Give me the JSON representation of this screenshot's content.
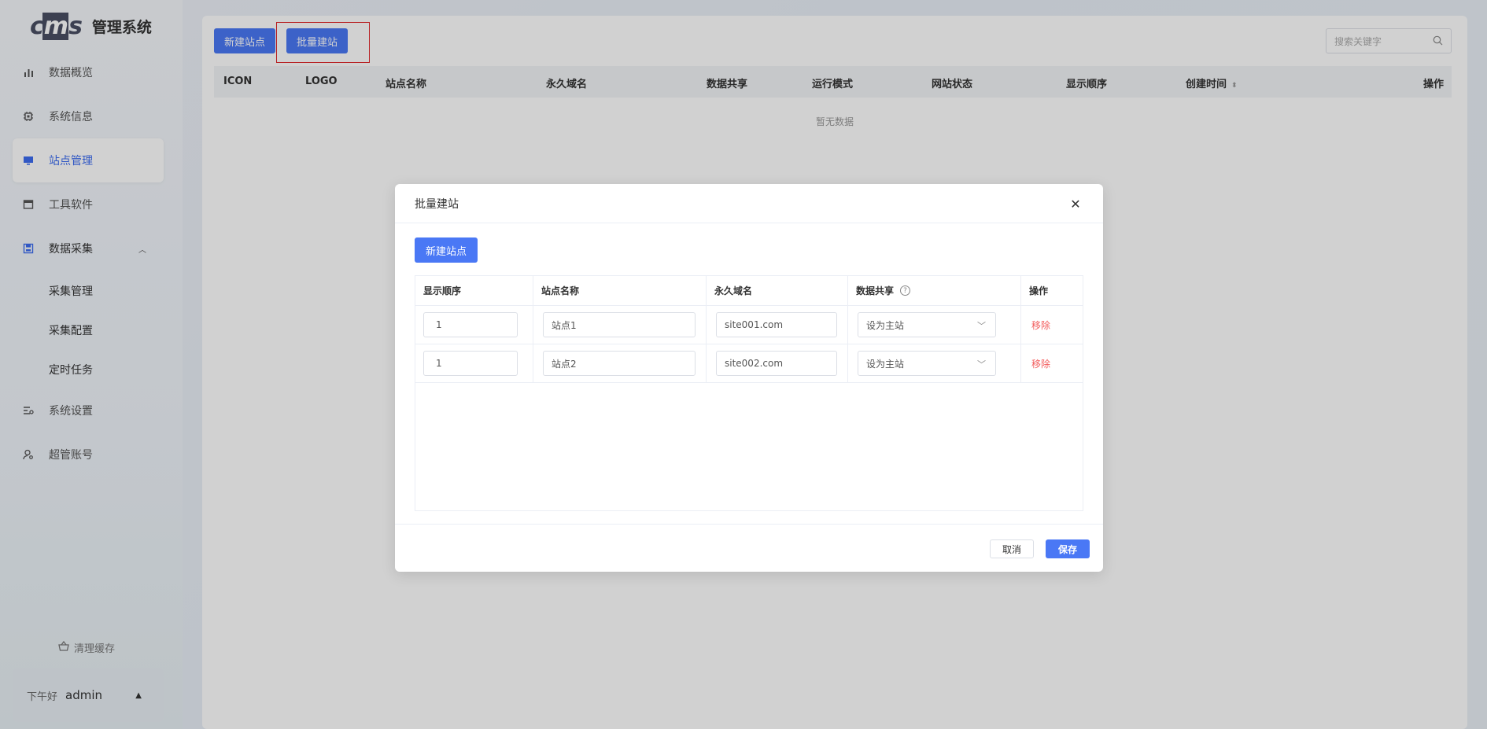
{
  "app": {
    "logo_text": "cms",
    "title": "管理系统"
  },
  "sidebar": {
    "items": [
      {
        "label": "数据概览",
        "icon": "bar-chart-icon"
      },
      {
        "label": "系统信息",
        "icon": "chip-icon"
      },
      {
        "label": "站点管理",
        "icon": "monitor-icon",
        "active": true
      },
      {
        "label": "工具软件",
        "icon": "window-icon"
      },
      {
        "label": "数据采集",
        "icon": "save-icon",
        "expanded": true
      },
      {
        "label": "系统设置",
        "icon": "settings-sliders-icon"
      },
      {
        "label": "超管账号",
        "icon": "user-gear-icon"
      }
    ],
    "sub_items": [
      "采集管理",
      "采集配置",
      "定时任务"
    ],
    "clear_cache": "清理缓存",
    "greeting": "下午好",
    "username": "admin"
  },
  "toolbar": {
    "new_site": "新建站点",
    "batch_create": "批量建站",
    "search_placeholder": "搜索关键字"
  },
  "table": {
    "columns": [
      "ICON",
      "LOGO",
      "站点名称",
      "永久域名",
      "数据共享",
      "运行模式",
      "网站状态",
      "显示顺序",
      "创建时间",
      "操作"
    ],
    "empty_text": "暂无数据"
  },
  "modal": {
    "title": "批量建站",
    "add_button": "新建站点",
    "columns": [
      "显示顺序",
      "站点名称",
      "永久域名",
      "数据共享",
      "操作"
    ],
    "rows": [
      {
        "order": "1",
        "name": "站点1",
        "domain": "site001.com",
        "share": "设为主站",
        "action": "移除"
      },
      {
        "order": "1",
        "name": "站点2",
        "domain": "site002.com",
        "share": "设为主站",
        "action": "移除"
      }
    ],
    "cancel": "取消",
    "save": "保存"
  },
  "colors": {
    "primary": "#4a78f5",
    "danger": "#f25c5c",
    "highlight_border": "#e0262a"
  }
}
